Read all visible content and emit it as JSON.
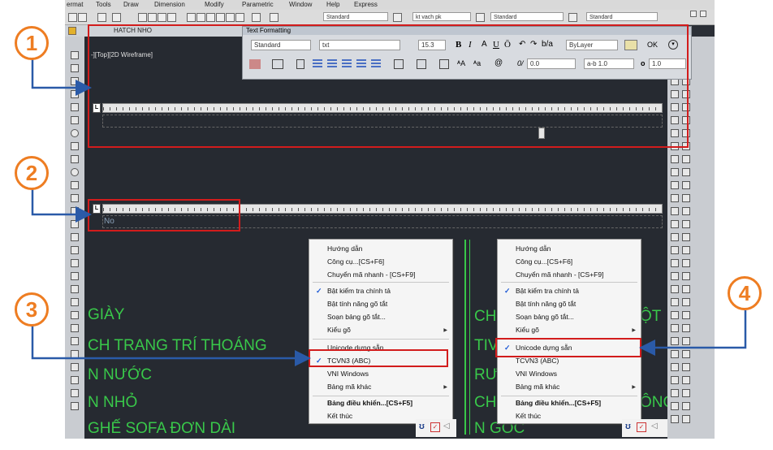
{
  "menubar": [
    "ermat",
    "Tools",
    "Draw",
    "Dimension",
    "Modify",
    "Parametric",
    "Window",
    "Help",
    "Express"
  ],
  "toolbar": {
    "style1": "Standard",
    "layer": "kt vach pk",
    "style2": "Standard",
    "style3": "Standard"
  },
  "window_title": "HATCH NHO",
  "viewport_label": "-][Top][2D Wireframe]",
  "text_formatting": {
    "title": "Text Formatting",
    "style": "Standard",
    "font": "txt",
    "height": "15.3",
    "bold": "B",
    "italic": "I",
    "underline": "U",
    "overline": "Ō",
    "color": "ByLayer",
    "ok": "OK",
    "oblique": "0.0",
    "tracking": "a-b 1.0",
    "width": "1.0"
  },
  "ruler_text": "No",
  "cad_text": [
    {
      "text": "GIÀY"
    },
    {
      "text": "CH TRANG TRÍ THOÁNG"
    },
    {
      "text": "N NƯỚC"
    },
    {
      "text": "N NHỎ"
    },
    {
      "text": "GHẾ SOFA ĐƠN  DÀI"
    },
    {
      "text": "CH"
    },
    {
      "text": "TIV"
    },
    {
      "text": "RƯƠ"
    },
    {
      "text": "CH"
    },
    {
      "text": "ÔNG"
    },
    {
      "text": "ỘT"
    },
    {
      "text": "N GÓC"
    }
  ],
  "menu_left": [
    {
      "label": "Hướng dẫn"
    },
    {
      "label": "Công cụ...[CS+F6]"
    },
    {
      "label": "Chuyển mã nhanh - [CS+F9]"
    },
    {
      "label": "Bật kiểm tra chính tả",
      "checked": true
    },
    {
      "label": "Bật tính năng gõ tắt"
    },
    {
      "label": "Soạn bảng gõ tắt..."
    },
    {
      "label": "Kiểu gõ",
      "submenu": true
    },
    {
      "label": "Unicode dựng sẵn"
    },
    {
      "label": "TCVN3 (ABC)",
      "checked": true
    },
    {
      "label": "VNI Windows"
    },
    {
      "label": "Bảng mã khác",
      "submenu": true
    },
    {
      "label": "Bảng điều khiển...[CS+F5]",
      "bold": true
    },
    {
      "label": "Kết thúc"
    }
  ],
  "menu_right": [
    {
      "label": "Hướng dẫn"
    },
    {
      "label": "Công cụ...[CS+F6]"
    },
    {
      "label": "Chuyển mã nhanh - [CS+F9]"
    },
    {
      "label": "Bật kiểm tra chính tả",
      "checked": true
    },
    {
      "label": "Bật tính năng gõ tắt"
    },
    {
      "label": "Soạn bảng gõ tắt..."
    },
    {
      "label": "Kiểu gõ",
      "submenu": true
    },
    {
      "label": "Unicode dựng sẵn",
      "checked": true
    },
    {
      "label": "TCVN3 (ABC)"
    },
    {
      "label": "VNI Windows"
    },
    {
      "label": "Bảng mã khác",
      "submenu": true
    },
    {
      "label": "Bảng điều khiển...[CS+F5]",
      "bold": true
    },
    {
      "label": "Kết thúc"
    }
  ],
  "callouts": [
    "1",
    "2",
    "3",
    "4"
  ],
  "colors": {
    "callout": "#ee7d22",
    "highlight": "#d21c1c",
    "arrow": "#2a5aa8",
    "cad_text": "#39c84a"
  }
}
